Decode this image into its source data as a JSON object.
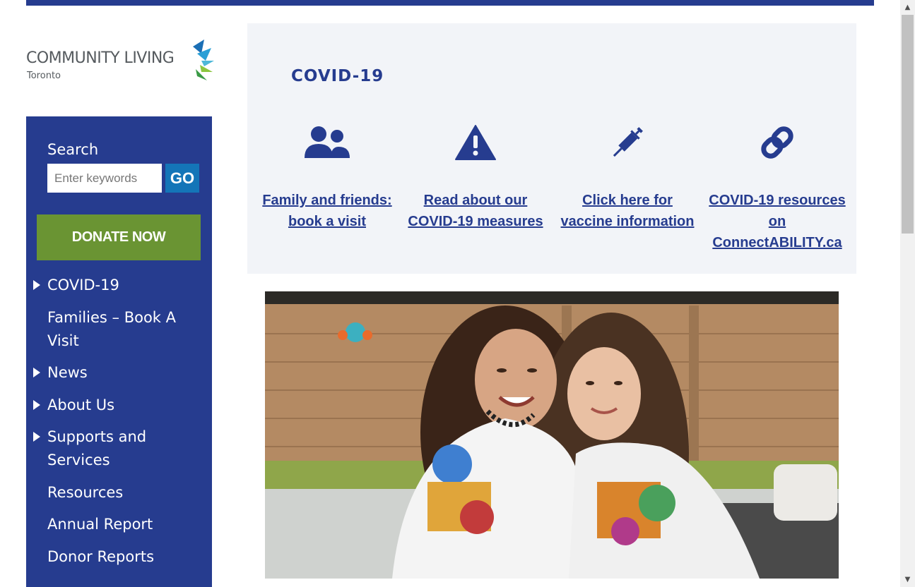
{
  "logo": {
    "name": "COMMUNITY LIVING",
    "sub": "Toronto"
  },
  "search": {
    "label": "Search",
    "placeholder": "Enter keywords",
    "button": "GO"
  },
  "donate": {
    "label": "DONATE NOW"
  },
  "nav": [
    {
      "label": "COVID-19",
      "has_arrow": true
    },
    {
      "label": "Families – Book A Visit",
      "has_arrow": false
    },
    {
      "label": "News",
      "has_arrow": true
    },
    {
      "label": "About Us",
      "has_arrow": true
    },
    {
      "label": "Supports and Services",
      "has_arrow": true
    },
    {
      "label": "Resources",
      "has_arrow": false
    },
    {
      "label": "Annual Report",
      "has_arrow": false
    },
    {
      "label": "Donor Reports",
      "has_arrow": false
    }
  ],
  "covid": {
    "title": "COVID-19",
    "cards": [
      {
        "icon": "users-icon",
        "label": "Family and friends: book a visit"
      },
      {
        "icon": "warning-icon",
        "label": "Read about our COVID-19 measures"
      },
      {
        "icon": "syringe-icon",
        "label": "Click here for vaccine information"
      },
      {
        "icon": "link-icon",
        "label": "COVID-19 resources on ConnectABILITY.ca"
      }
    ]
  },
  "colors": {
    "brand_blue": "#263c8f",
    "go_blue": "#1475b8",
    "donate_green": "#6a9433",
    "panel_bg": "#f2f4f8"
  }
}
